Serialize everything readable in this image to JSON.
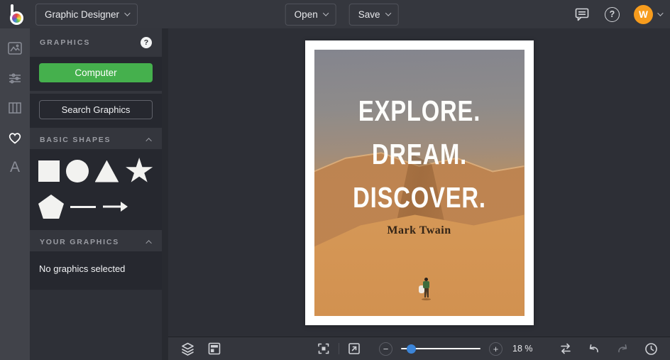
{
  "topbar": {
    "app_menu": "Graphic Designer",
    "open": "Open",
    "save": "Save",
    "help_glyph": "?",
    "avatar_initial": "W"
  },
  "sidebar": {
    "text_tool_glyph": "A"
  },
  "graphics_panel": {
    "title": "GRAPHICS",
    "help_glyph": "?",
    "computer_button": "Computer",
    "search_button": "Search Graphics",
    "basic_shapes_title": "BASIC SHAPES",
    "your_graphics_title": "YOUR GRAPHICS",
    "empty_message": "No graphics selected"
  },
  "canvas": {
    "poster": {
      "lines": [
        "EXPLORE.",
        "DREAM.",
        "DISCOVER."
      ],
      "author": "Mark Twain"
    }
  },
  "bottombar": {
    "zoom_out_glyph": "−",
    "zoom_in_glyph": "+",
    "zoom_value": "18 %"
  },
  "colors": {
    "accent_green": "#45b04d",
    "avatar_orange": "#f79c1d",
    "slider_blue": "#3c85d8"
  }
}
